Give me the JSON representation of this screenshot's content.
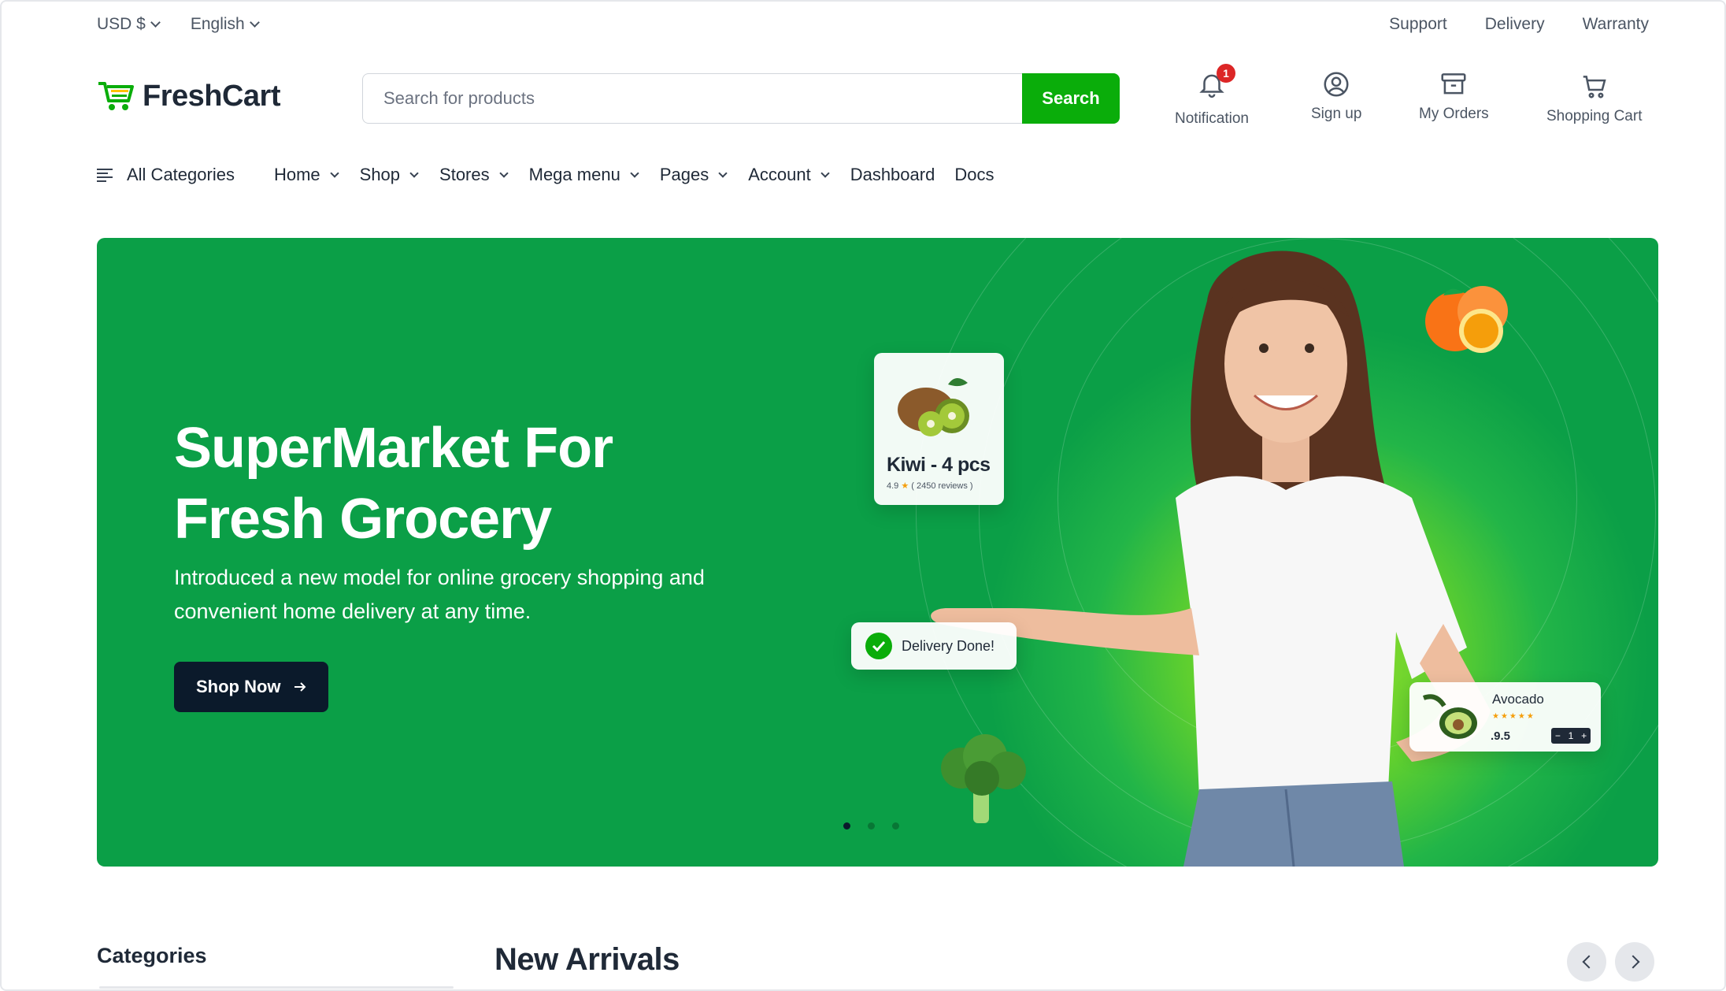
{
  "topbar": {
    "currency": "USD $",
    "language": "English",
    "links": [
      "Support",
      "Delivery",
      "Warranty"
    ]
  },
  "header": {
    "logo_text": "FreshCart",
    "search_placeholder": "Search for products",
    "search_button": "Search",
    "notification_label": "Notification",
    "notification_count": "1",
    "signup_label": "Sign up",
    "orders_label": "My Orders",
    "cart_label": "Shopping Cart"
  },
  "nav": {
    "all_categories": "All Categories",
    "dropdown_items": [
      "Home",
      "Shop",
      "Stores",
      "Mega menu",
      "Pages",
      "Account"
    ],
    "plain_items": [
      "Dashboard",
      "Docs"
    ]
  },
  "hero": {
    "title_line1": "SuperMarket For",
    "title_line2": "Fresh Grocery",
    "subtitle": "Introduced a new model for online grocery shopping and convenient home delivery at any time.",
    "cta": "Shop Now",
    "kiwi_card": {
      "name": "Kiwi - 4 pcs",
      "rating": "4.9",
      "reviews": "( 2450 reviews )"
    },
    "delivery_card": {
      "text": "Delivery Done!"
    },
    "avocado_card": {
      "name": "Avocado",
      "price": ".9.5",
      "qty": "1"
    },
    "slides": 3,
    "active_slide": 1
  },
  "sections": {
    "categories_title": "Categories",
    "new_arrivals_title": "New Arrivals"
  },
  "colors": {
    "brand_green": "#0aad0a",
    "hero_green": "#0b9f47",
    "dark_button": "#0b1a2b",
    "badge_red": "#dc2626"
  },
  "icons": [
    "chevron-down-icon",
    "cart-logo-icon",
    "bell-icon",
    "user-circle-icon",
    "archive-box-icon",
    "shopping-cart-icon",
    "menu-lines-icon",
    "arrow-right-icon",
    "check-icon",
    "chevron-left-icon",
    "chevron-right-icon"
  ]
}
